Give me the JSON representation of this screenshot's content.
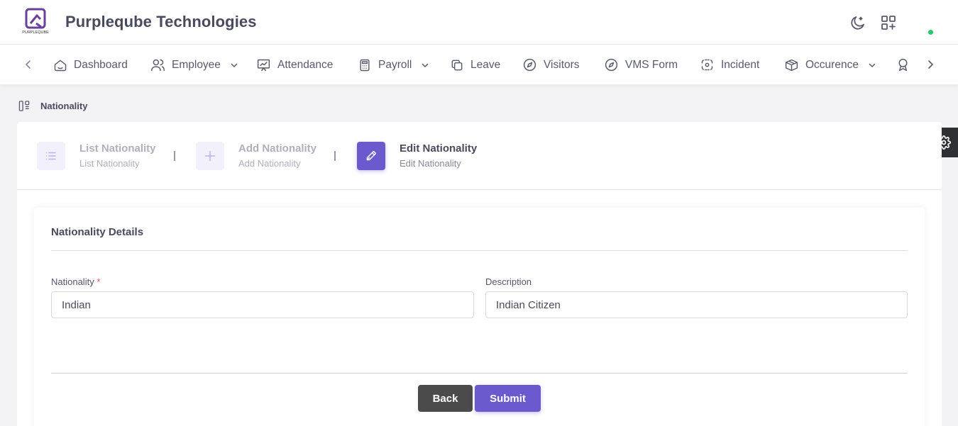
{
  "header": {
    "brand": "Purpleqube Technologies",
    "logo_text": "PURPLEQUBE",
    "icons": [
      "moon-icon",
      "apps-add-icon"
    ],
    "status_color": "#28c76f"
  },
  "nav": {
    "items": [
      {
        "label": "Dashboard",
        "icon": "home-icon",
        "dropdown": false
      },
      {
        "label": "Employee",
        "icon": "users-icon",
        "dropdown": true
      },
      {
        "label": "Attendance",
        "icon": "presentation-icon",
        "dropdown": false
      },
      {
        "label": "Payroll",
        "icon": "calculator-icon",
        "dropdown": true
      },
      {
        "label": "Leave",
        "icon": "copy-icon",
        "dropdown": false
      },
      {
        "label": "Visitors",
        "icon": "compass-icon",
        "dropdown": false
      },
      {
        "label": "VMS Form",
        "icon": "compass-icon",
        "dropdown": false
      },
      {
        "label": "Incident",
        "icon": "focus-icon",
        "dropdown": false
      },
      {
        "label": "Occurence",
        "icon": "package-icon",
        "dropdown": true
      }
    ]
  },
  "breadcrumb": {
    "label": "Nationality"
  },
  "steps": [
    {
      "title": "List Nationality",
      "subtitle": "List Nationality",
      "icon": "list-icon",
      "active": false
    },
    {
      "title": "Add Nationality",
      "subtitle": "Add Nationality",
      "icon": "plus-icon",
      "active": false
    },
    {
      "title": "Edit Nationality",
      "subtitle": "Edit Nationality",
      "icon": "pencil-icon",
      "active": true
    }
  ],
  "form": {
    "section_title": "Nationality Details",
    "nationality": {
      "label": "Nationality",
      "required_mark": "*",
      "value": "Indian"
    },
    "description": {
      "label": "Description",
      "value": "Indian Citizen"
    },
    "back_label": "Back",
    "submit_label": "Submit"
  },
  "colors": {
    "accent": "#6a5acd",
    "back_button": "#4b4b4b",
    "required": "#ea5455"
  }
}
